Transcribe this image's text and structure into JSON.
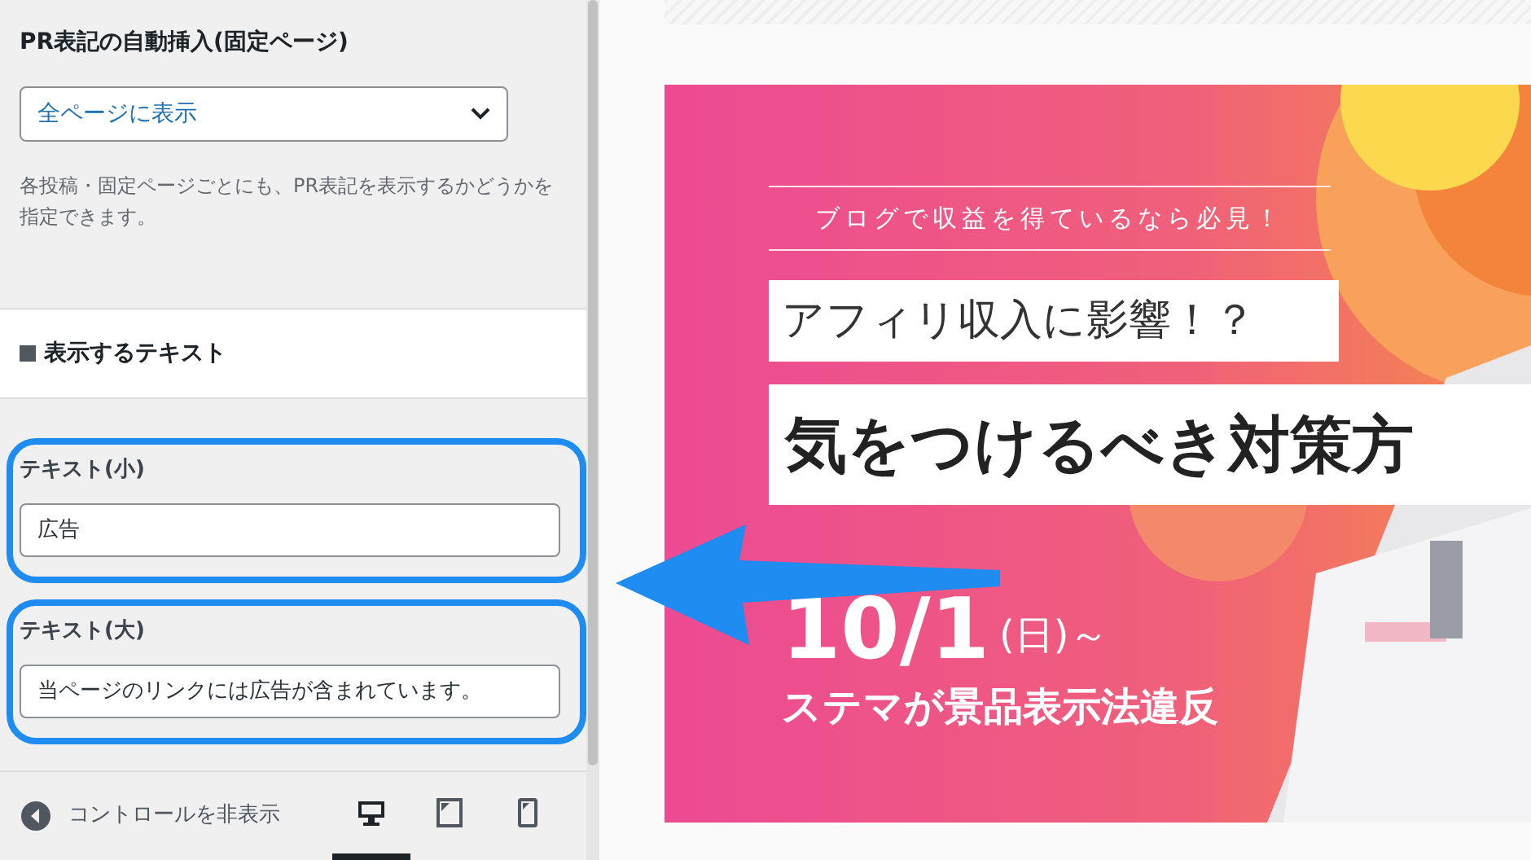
{
  "settings": {
    "title": "PR表記の自動挿入(固定ページ)",
    "select": {
      "value": "全ページに表示"
    },
    "help": "各投稿・固定ページごとにも、PR表記を表示するかどうかを指定できます。"
  },
  "section": {
    "title": "表示するテキスト"
  },
  "fields": [
    {
      "label": "テキスト(小)",
      "value": "広告",
      "highlighted": true
    },
    {
      "label": "テキスト(大)",
      "value": "当ページのリンクには広告が含まれています。",
      "highlighted": true
    }
  ],
  "footer": {
    "toggle": "コントロールを非表示",
    "devices": [
      {
        "kind": "desktop",
        "selected": true
      },
      {
        "kind": "tablet",
        "selected": false
      },
      {
        "kind": "mobile",
        "selected": false
      }
    ]
  },
  "banner": {
    "tagline": "ブログで収益を得ているなら必見！",
    "headline": "アフィリ収入に影響！？",
    "title": "気をつけるべき対策方",
    "date": "10/1",
    "weekday": "(日)～",
    "note": "ステマが景品表示法違反"
  }
}
